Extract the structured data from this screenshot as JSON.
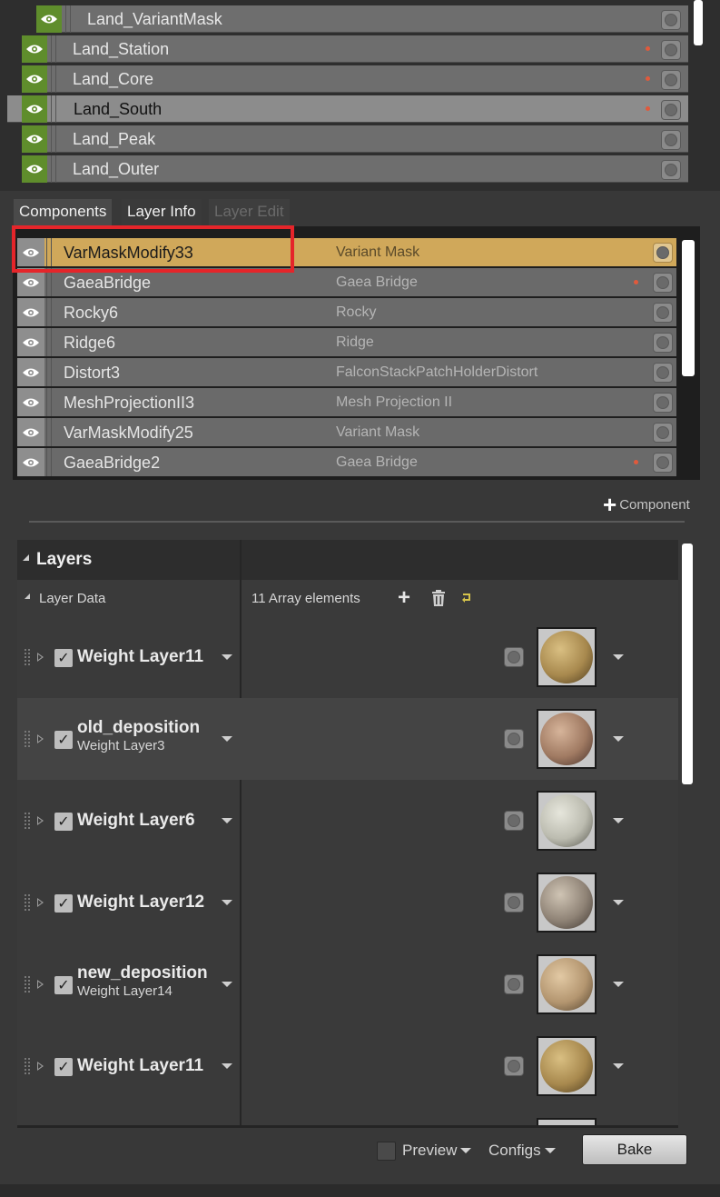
{
  "land_list": {
    "items": [
      {
        "label": "Land_VariantMask",
        "dirty": false
      },
      {
        "label": "Land_Station",
        "dirty": true
      },
      {
        "label": "Land_Core",
        "dirty": true
      },
      {
        "label": "Land_South",
        "dirty": true,
        "selected": true
      },
      {
        "label": "Land_Peak",
        "dirty": false
      },
      {
        "label": "Land_Outer",
        "dirty": false
      }
    ]
  },
  "tabs": [
    {
      "label": "Components",
      "state": "active"
    },
    {
      "label": "Layer Info",
      "state": "normal"
    },
    {
      "label": "Layer Edit",
      "state": "disabled"
    }
  ],
  "components": {
    "items": [
      {
        "name": "VarMaskModify33",
        "type": "Variant Mask",
        "selected": true,
        "dirty": false
      },
      {
        "name": "GaeaBridge",
        "type": "Gaea Bridge",
        "dirty": true
      },
      {
        "name": "Rocky6",
        "type": "Rocky",
        "dirty": false
      },
      {
        "name": "Ridge6",
        "type": "Ridge",
        "dirty": false
      },
      {
        "name": "Distort3",
        "type": "FalconStackPatchHolderDistort",
        "dirty": false
      },
      {
        "name": "MeshProjectionII3",
        "type": "Mesh Projection II",
        "dirty": false
      },
      {
        "name": "VarMaskModify25",
        "type": "Variant Mask",
        "dirty": false
      },
      {
        "name": "GaeaBridge2",
        "type": "Gaea Bridge",
        "dirty": true
      }
    ],
    "add_button_label": "Component"
  },
  "layers": {
    "section_title": "Layers",
    "layer_data_label": "Layer Data",
    "array_count_label": "11 Array elements",
    "rows": [
      {
        "title": "Weight Layer11",
        "subtitle": "",
        "checked": true,
        "material_color": "#a8894e"
      },
      {
        "title": "old_deposition",
        "subtitle": "Weight Layer3",
        "checked": true,
        "material_color": "#a07a62"
      },
      {
        "title": "Weight Layer6",
        "subtitle": "",
        "checked": true,
        "material_color": "#bcbcb0"
      },
      {
        "title": "Weight Layer12",
        "subtitle": "",
        "checked": true,
        "material_color": "#8f8376"
      },
      {
        "title": "new_deposition",
        "subtitle": "Weight Layer14",
        "checked": true,
        "material_color": "#b49670"
      },
      {
        "title": "Weight Layer11",
        "subtitle": "",
        "checked": true,
        "material_color": "#a8894e"
      }
    ]
  },
  "footer": {
    "preview_label": "Preview",
    "configs_label": "Configs",
    "bake_label": "Bake"
  },
  "colors": {
    "eye_active": "#5f8d2c",
    "selected_component": "#d0a85a",
    "highlight_box": "#e5252a",
    "dirty_dot": "#e05a3c"
  }
}
